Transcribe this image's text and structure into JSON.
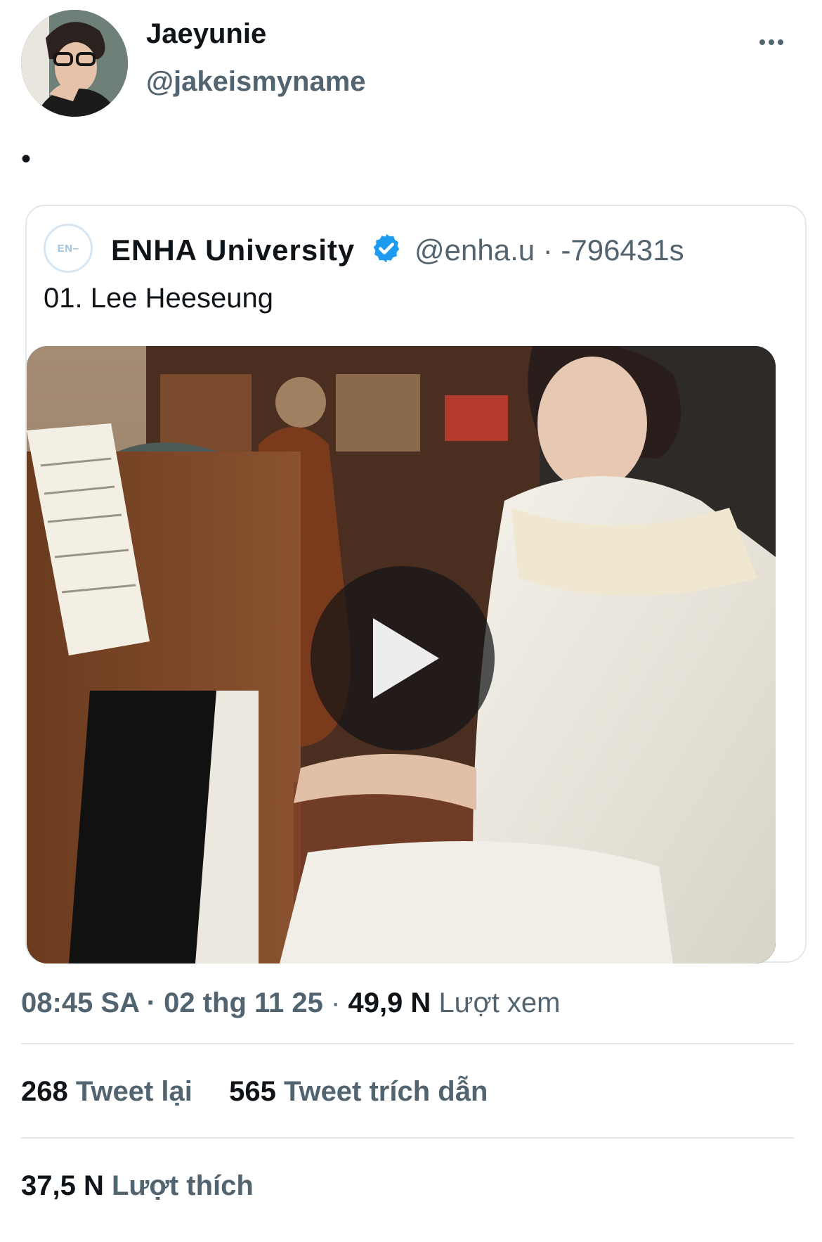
{
  "author": {
    "display_name": "Jaeyunie",
    "handle": "@jakeismyname",
    "avatar_icon": "profile-photo"
  },
  "tweet": {
    "text": "•"
  },
  "quoted": {
    "avatar_text": "EN–",
    "name": "ENHA University",
    "verified": true,
    "handle": "@enha.u",
    "separator": "·",
    "time": "-796431s",
    "text": "01. Lee Heeseung",
    "media_type": "video",
    "play_icon": "play-icon"
  },
  "meta": {
    "time": "08:45 SA",
    "dot1": "·",
    "date": "02 thg 11 25",
    "dot2": "·",
    "views_count": "49,9 N",
    "views_label": "Lượt xem"
  },
  "stats": {
    "retweets_count": "268",
    "retweets_label": "Tweet lại",
    "quotes_count": "565",
    "quotes_label": "Tweet trích dẫn",
    "likes_count": "37,5 N",
    "likes_label": "Lượt thích"
  },
  "colors": {
    "text_primary": "#0f1419",
    "text_secondary": "#536471",
    "verified_blue": "#1d9bf0",
    "divider": "#e1e8ed"
  }
}
